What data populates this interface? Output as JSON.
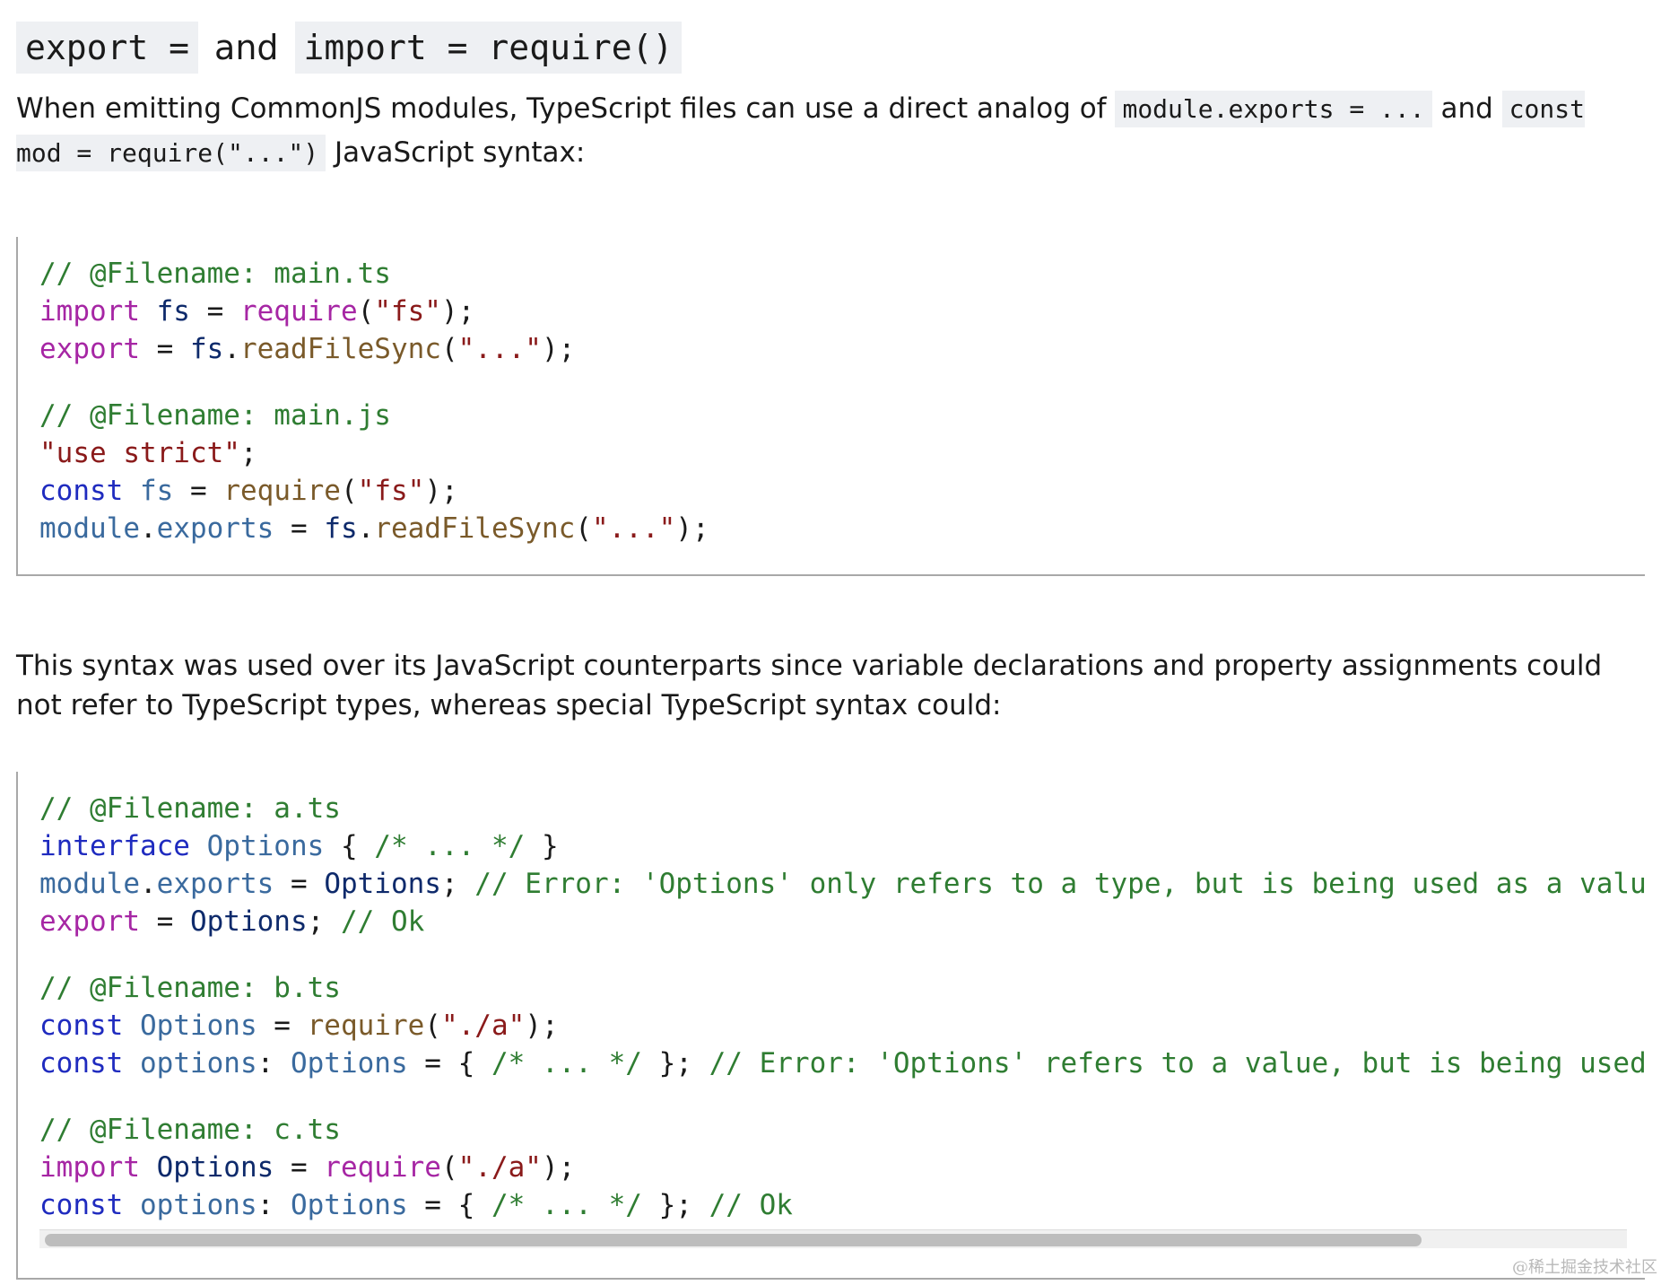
{
  "heading": {
    "part1": "export =",
    "conj": "and",
    "part2": "import = require()"
  },
  "para1": {
    "text_a": "When emitting CommonJS modules, TypeScript files can use a direct analog of ",
    "code_a": "module.exports = ...",
    "text_b": " and ",
    "code_b": "const mod = require(\"...\")",
    "text_c": " JavaScript syntax:"
  },
  "code1": {
    "l1": "// @Filename: main.ts",
    "l2_kw": "import",
    "l2_id": " fs",
    "l2_op": " = ",
    "l2_fn": "require",
    "l2_p1": "(",
    "l2_str": "\"fs\"",
    "l2_p2": ");",
    "l3_kw": "export",
    "l3_op": " = ",
    "l3_id": "fs",
    "l3_dot": ".",
    "l3_fn": "readFileSync",
    "l3_p1": "(",
    "l3_str": "\"...\"",
    "l3_p2": ");",
    "l4": "// @Filename: main.js",
    "l5_str": "\"use strict\"",
    "l5_p": ";",
    "l6_kw": "const",
    "l6_var": " fs",
    "l6_op": " = ",
    "l6_fn": "require",
    "l6_p1": "(",
    "l6_str": "\"fs\"",
    "l6_p2": ");",
    "l7_var1": "module",
    "l7_dot": ".",
    "l7_var2": "exports",
    "l7_op": " = ",
    "l7_id": "fs",
    "l7_dot2": ".",
    "l7_fn": "readFileSync",
    "l7_p1": "(",
    "l7_str": "\"...\"",
    "l7_p2": ");"
  },
  "para2": {
    "text": "This syntax was used over its JavaScript counterparts since variable declarations and property assignments could not refer to TypeScript types, whereas special TypeScript syntax could:"
  },
  "code2": {
    "a1": "// @Filename: a.ts",
    "a2_kw": "interface",
    "a2_var": " Options",
    "a2_b1": " { ",
    "a2_com": "/* ... */",
    "a2_b2": " }",
    "a3_var1": "module",
    "a3_dot": ".",
    "a3_var2": "exports",
    "a3_op": " = ",
    "a3_id": "Options",
    "a3_semi": "; ",
    "a3_com": "// Error: 'Options' only refers to a type, but is being used as a value",
    "a4_kw": "export",
    "a4_op": " = ",
    "a4_id": "Options",
    "a4_semi": "; ",
    "a4_com": "// Ok",
    "b1": "// @Filename: b.ts",
    "b2_kw": "const",
    "b2_var": " Options",
    "b2_op": " = ",
    "b2_fn": "require",
    "b2_p1": "(",
    "b2_str": "\"./a\"",
    "b2_p2": ");",
    "b3_kw": "const",
    "b3_var": " options",
    "b3_colon": ": ",
    "b3_type": "Options",
    "b3_op": " = { ",
    "b3_com1": "/* ... */",
    "b3_close": " }; ",
    "b3_com2": "// Error: 'Options' refers to a value, but is being used as a type here.",
    "c1": "// @Filename: c.ts",
    "c2_kw": "import",
    "c2_id": " Options",
    "c2_op": " = ",
    "c2_fn": "require",
    "c2_p1": "(",
    "c2_str": "\"./a\"",
    "c2_p2": ");",
    "c3_kw": "const",
    "c3_var": " options",
    "c3_colon": ": ",
    "c3_type": "Options",
    "c3_op": " = { ",
    "c3_com1": "/* ... */",
    "c3_close": " }; ",
    "c3_com2": "// Ok"
  },
  "watermark": "@稀土掘金技术社区"
}
